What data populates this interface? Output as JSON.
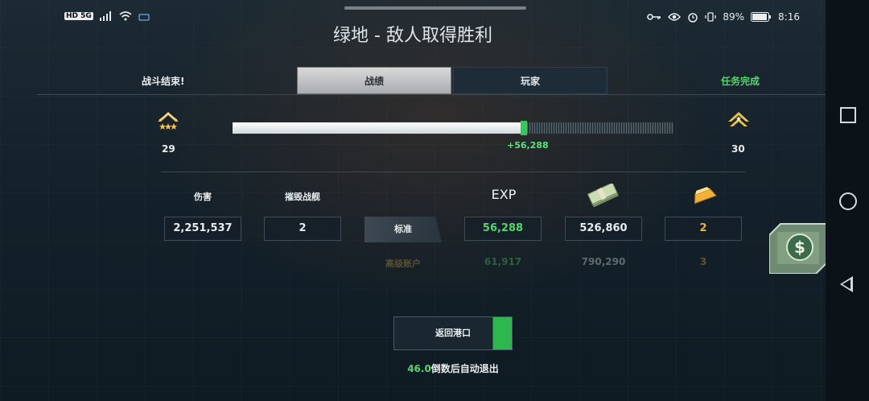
{
  "statusbar": {
    "left_network": "HD 5G",
    "battery_pct": "89%",
    "time": "8:16"
  },
  "title": "绿地 - 敌人取得胜利",
  "tabbar": {
    "left_label": "战斗结束!",
    "tab_stats": "战绩",
    "tab_players": "玩家",
    "right_label": "任务完成"
  },
  "rank": {
    "current_level": "29",
    "next_level": "30",
    "xp_gain": "+56,288",
    "xp_progress": 0.66
  },
  "stats": {
    "damage_label": "伤害",
    "damage_value": "2,251,537",
    "destroyed_label": "摧毁战舰",
    "destroyed_value": "2",
    "exp_label": "EXP",
    "standard_label": "标准",
    "standard_exp": "56,288",
    "standard_credits": "526,860",
    "standard_gold": "2",
    "premium_label": "高级账户",
    "premium_exp": "61,917",
    "premium_credits": "790,290",
    "premium_gold": "3"
  },
  "actions": {
    "return_label": "返回港口",
    "countdown_value": "46.0",
    "countdown_text": "倒数后自动退出"
  },
  "colors": {
    "accent_green": "#55d46b",
    "gold": "#f0b23a"
  },
  "icons": {
    "rank_current": "rank-chevron-three-stars-icon",
    "rank_next": "rank-chevron-star-icon",
    "credits": "cash-stack-icon",
    "gold": "gold-bar-icon",
    "floating": "dollar-coin-icon"
  }
}
